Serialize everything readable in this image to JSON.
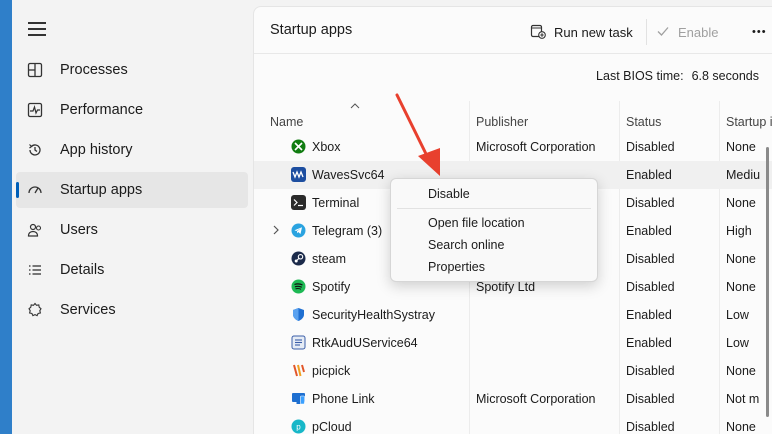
{
  "sidebar": {
    "items": [
      {
        "label": "Processes",
        "icon": "processes-icon"
      },
      {
        "label": "Performance",
        "icon": "performance-icon"
      },
      {
        "label": "App history",
        "icon": "history-icon"
      },
      {
        "label": "Startup apps",
        "icon": "startup-icon",
        "active": true
      },
      {
        "label": "Users",
        "icon": "users-icon"
      },
      {
        "label": "Details",
        "icon": "details-icon"
      },
      {
        "label": "Services",
        "icon": "services-icon"
      }
    ]
  },
  "header": {
    "title": "Startup apps",
    "run_new_task": "Run new task",
    "enable": "Enable",
    "more": "•••"
  },
  "bios": {
    "label": "Last BIOS time:",
    "value": "6.8 seconds"
  },
  "columns": {
    "name": "Name",
    "publisher": "Publisher",
    "status": "Status",
    "impact": "Startup i"
  },
  "rows": [
    {
      "name": "Xbox",
      "publisher": "Microsoft Corporation",
      "status": "Disabled",
      "impact": "None"
    },
    {
      "name": "WavesSvc64",
      "publisher": "",
      "status": "Enabled",
      "impact": "Mediu"
    },
    {
      "name": "Terminal",
      "publisher": "n",
      "status": "Disabled",
      "impact": "None"
    },
    {
      "name": "Telegram (3)",
      "publisher": "",
      "status": "Enabled",
      "impact": "High"
    },
    {
      "name": "steam",
      "publisher": "",
      "status": "Disabled",
      "impact": "None"
    },
    {
      "name": "Spotify",
      "publisher": "Spotify Ltd",
      "status": "Disabled",
      "impact": "None"
    },
    {
      "name": "SecurityHealthSystray",
      "publisher": "",
      "status": "Enabled",
      "impact": "Low"
    },
    {
      "name": "RtkAudUService64",
      "publisher": "",
      "status": "Enabled",
      "impact": "Low"
    },
    {
      "name": "picpick",
      "publisher": "",
      "status": "Disabled",
      "impact": "None"
    },
    {
      "name": "Phone Link",
      "publisher": "Microsoft Corporation",
      "status": "Disabled",
      "impact": "Not m"
    },
    {
      "name": "pCloud",
      "publisher": "",
      "status": "Disabled",
      "impact": "None"
    }
  ],
  "context_menu": {
    "disable": "Disable",
    "open_location": "Open file location",
    "search_online": "Search online",
    "properties": "Properties"
  },
  "colors": {
    "accent": "#005fb8",
    "annotation": "#e8402e"
  }
}
